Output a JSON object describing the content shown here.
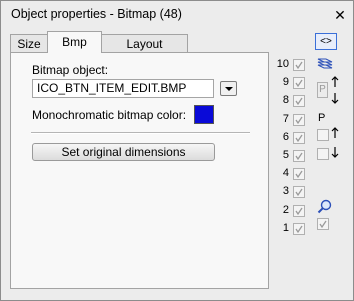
{
  "window": {
    "title": "Object properties - Bitmap (48)",
    "close_label": "✕"
  },
  "tabs": [
    {
      "label": "Size"
    },
    {
      "label": "Bmp"
    },
    {
      "label": "Layout manager"
    }
  ],
  "bmp": {
    "bitmap_object_label": "Bitmap object:",
    "bitmap_object_value": "ICO_BTN_ITEM_EDIT.BMP",
    "mono_color_label": "Monochromatic bitmap color:",
    "mono_color": "#0a0ad8",
    "set_original_label": "Set original dimensions"
  },
  "layers": {
    "numbers": [
      "10",
      "9",
      "8",
      "7",
      "6",
      "5",
      "4",
      "3",
      "2",
      "1"
    ]
  },
  "right_panel": {
    "toggle_label": "<>",
    "p_top": "P",
    "p_label": "P"
  }
}
